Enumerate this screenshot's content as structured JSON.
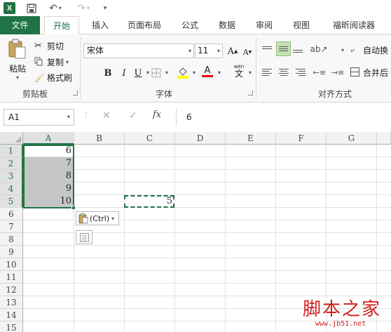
{
  "app": {
    "logo_text": "X"
  },
  "tabs": [
    "文件",
    "开始",
    "插入",
    "页面布局",
    "公式",
    "数据",
    "审阅",
    "视图",
    "福昕阅读器"
  ],
  "ribbon": {
    "clipboard": {
      "paste": "粘贴",
      "cut": "剪切",
      "copy": "复制",
      "format_painter": "格式刷",
      "group_label": "剪贴板"
    },
    "font": {
      "font_name": "宋体",
      "font_size": "11",
      "bold": "B",
      "italic": "I",
      "underline": "U",
      "wen": "wén",
      "wen_char": "文",
      "font_color_letter": "A",
      "grow": "A",
      "shrink": "A",
      "group_label": "字体"
    },
    "alignment": {
      "wrap": "自动换",
      "merge": "合并后",
      "group_label": "对齐方式"
    }
  },
  "formula_bar": {
    "name_box": "A1",
    "fx": "fx",
    "value": "6"
  },
  "grid": {
    "columns": [
      "A",
      "B",
      "C",
      "D",
      "E",
      "F",
      "G"
    ],
    "rows": [
      "1",
      "2",
      "3",
      "4",
      "5",
      "6",
      "7",
      "8",
      "9",
      "10",
      "11",
      "12",
      "13",
      "14",
      "15"
    ],
    "column_a_values": [
      "6",
      "7",
      "8",
      "9",
      "10"
    ],
    "c5_value": "5"
  },
  "paste_options": {
    "label": "(Ctrl)"
  },
  "watermark": {
    "title": "脚本之家",
    "url": "www.jb51.net"
  },
  "colors": {
    "accent": "#217346",
    "selection_fill": "#c6c6c6",
    "watermark": "#d21e1e"
  }
}
